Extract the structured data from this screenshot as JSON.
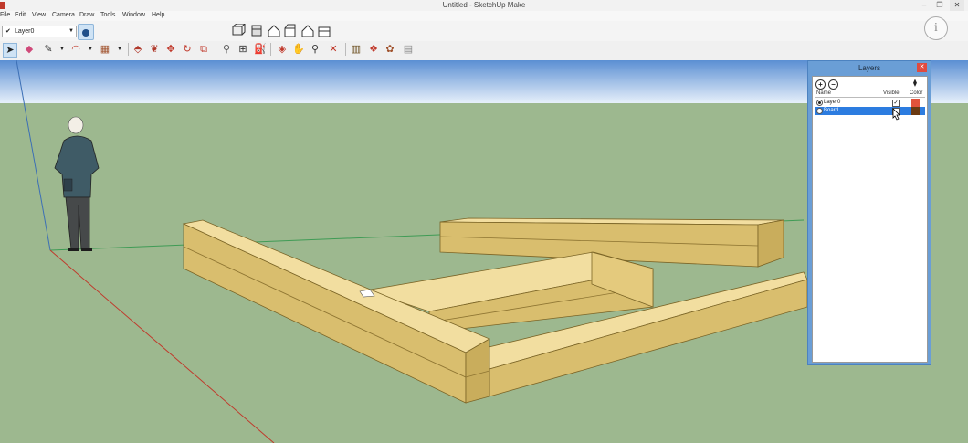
{
  "window": {
    "title": "Untitled - SketchUp Make"
  },
  "menu": [
    "File",
    "Edit",
    "View",
    "Camera",
    "Draw",
    "Tools",
    "Window",
    "Help"
  ],
  "layer_toolbar": {
    "current_layer": "Layer0"
  },
  "layers_panel": {
    "title": "Layers",
    "columns": {
      "name": "Name",
      "visible": "Visible",
      "color": "Color"
    },
    "rows": [
      {
        "name": "Layer0",
        "active": true,
        "visible": true,
        "color": "#e2533b"
      },
      {
        "name": "Board",
        "active": false,
        "visible": false,
        "color": "#6b3a12",
        "selected": true
      }
    ]
  },
  "colors": {
    "sky_top": "#5b8fd3",
    "sky_bottom": "#e7f0fa",
    "ground": "#9db88f",
    "wood_top": "#f2dea0",
    "wood_side": "#d9be6e",
    "wood_dark": "#b39546",
    "panel_frame": "#6a9ed6"
  },
  "icons": {
    "view_toolbar": [
      "iso-view-icon",
      "top-view-icon",
      "front-view-icon",
      "right-view-icon",
      "back-view-icon",
      "left-view-icon"
    ],
    "info": "i"
  }
}
